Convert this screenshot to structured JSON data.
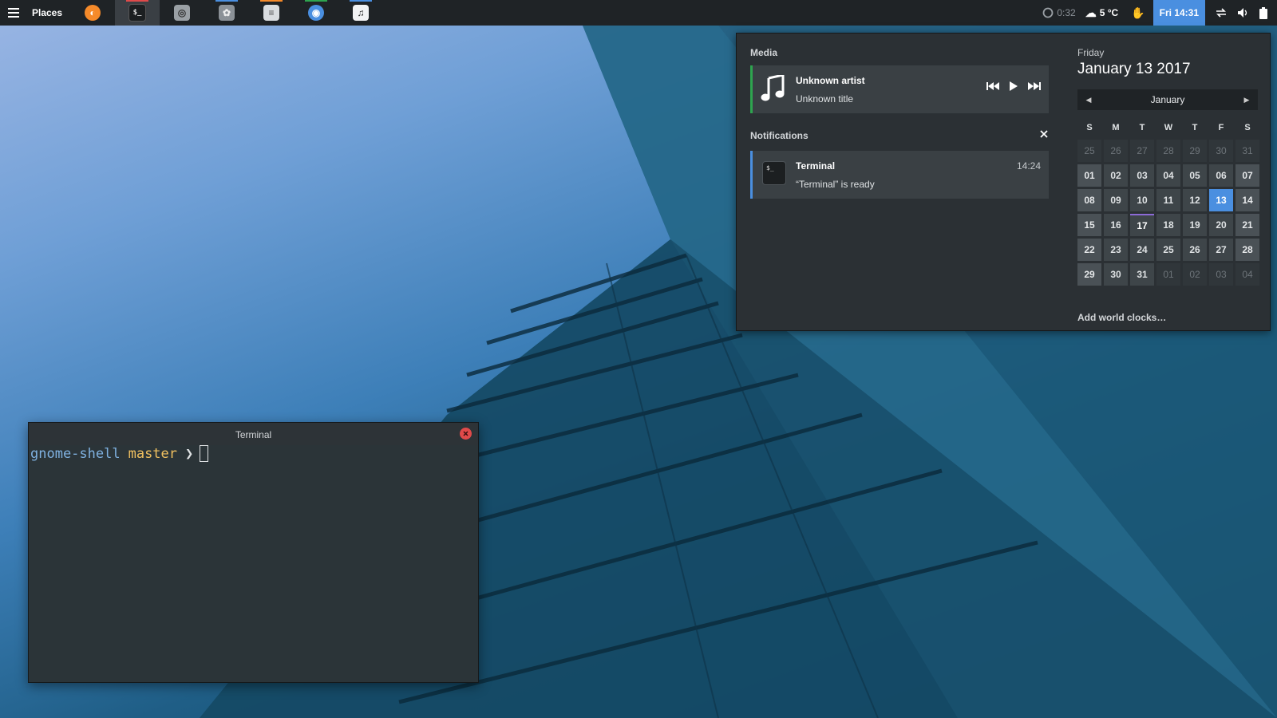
{
  "topbar": {
    "places_label": "Places",
    "launchers": [
      {
        "name": "firefox",
        "icon": "firefox-icon",
        "color": "#f58a2a",
        "indicator": ""
      },
      {
        "name": "terminal",
        "icon": "terminal-icon",
        "color": "#1c1f21",
        "indicator": "#e04a4a"
      },
      {
        "name": "disks",
        "icon": "disk-icon",
        "color": "#9aa0a5",
        "indicator": ""
      },
      {
        "name": "photos",
        "icon": "photos-icon",
        "color": "#8b9197",
        "indicator": "#4a8fe0"
      },
      {
        "name": "text-editor",
        "icon": "document-icon",
        "color": "#d9dcdf",
        "indicator": "#f58a2a"
      },
      {
        "name": "chromium",
        "icon": "chrome-icon",
        "color": "#4a8fe0",
        "indicator": "#2ea44f"
      },
      {
        "name": "music",
        "icon": "music-icon",
        "color": "#f2f3f4",
        "indicator": "#4a8fe0"
      }
    ],
    "timer": "0:32",
    "weather": "5 °C",
    "clock": "Fri 14:31"
  },
  "media": {
    "section_title": "Media",
    "artist": "Unknown artist",
    "title": "Unknown title"
  },
  "notifications": {
    "section_title": "Notifications",
    "items": [
      {
        "app": "Terminal",
        "time": "14:24",
        "body": "“Terminal” is ready"
      }
    ]
  },
  "calendar": {
    "weekday": "Friday",
    "date": "January 13 2017",
    "month": "January",
    "day_headers": [
      "S",
      "M",
      "T",
      "W",
      "T",
      "F",
      "S"
    ],
    "weeks": [
      [
        {
          "d": "25",
          "k": "other"
        },
        {
          "d": "26",
          "k": "other"
        },
        {
          "d": "27",
          "k": "other"
        },
        {
          "d": "28",
          "k": "other"
        },
        {
          "d": "29",
          "k": "other"
        },
        {
          "d": "30",
          "k": "other"
        },
        {
          "d": "31",
          "k": "other"
        }
      ],
      [
        {
          "d": "01",
          "k": "weekend"
        },
        {
          "d": "02",
          "k": "work"
        },
        {
          "d": "03",
          "k": "work"
        },
        {
          "d": "04",
          "k": "work"
        },
        {
          "d": "05",
          "k": "work"
        },
        {
          "d": "06",
          "k": "work"
        },
        {
          "d": "07",
          "k": "weekend"
        }
      ],
      [
        {
          "d": "08",
          "k": "weekend"
        },
        {
          "d": "09",
          "k": "work"
        },
        {
          "d": "10",
          "k": "work"
        },
        {
          "d": "11",
          "k": "work"
        },
        {
          "d": "12",
          "k": "work"
        },
        {
          "d": "13",
          "k": "today"
        },
        {
          "d": "14",
          "k": "weekend"
        }
      ],
      [
        {
          "d": "15",
          "k": "weekend"
        },
        {
          "d": "16",
          "k": "work"
        },
        {
          "d": "17",
          "k": "marked"
        },
        {
          "d": "18",
          "k": "work"
        },
        {
          "d": "19",
          "k": "work"
        },
        {
          "d": "20",
          "k": "work"
        },
        {
          "d": "21",
          "k": "weekend"
        }
      ],
      [
        {
          "d": "22",
          "k": "weekend"
        },
        {
          "d": "23",
          "k": "work"
        },
        {
          "d": "24",
          "k": "work"
        },
        {
          "d": "25",
          "k": "work"
        },
        {
          "d": "26",
          "k": "work"
        },
        {
          "d": "27",
          "k": "work"
        },
        {
          "d": "28",
          "k": "weekend"
        }
      ],
      [
        {
          "d": "29",
          "k": "weekend"
        },
        {
          "d": "30",
          "k": "work"
        },
        {
          "d": "31",
          "k": "work"
        },
        {
          "d": "01",
          "k": "other"
        },
        {
          "d": "02",
          "k": "other"
        },
        {
          "d": "03",
          "k": "other"
        },
        {
          "d": "04",
          "k": "other"
        }
      ]
    ],
    "world_clocks_label": "Add world clocks…"
  },
  "terminal": {
    "title": "Terminal",
    "dir": "gnome-shell",
    "branch": "master",
    "prompt": "❯"
  },
  "colors": {
    "accent": "#4a8fe0",
    "media_accent": "#2ea44f",
    "close_red": "#e04a4a"
  }
}
